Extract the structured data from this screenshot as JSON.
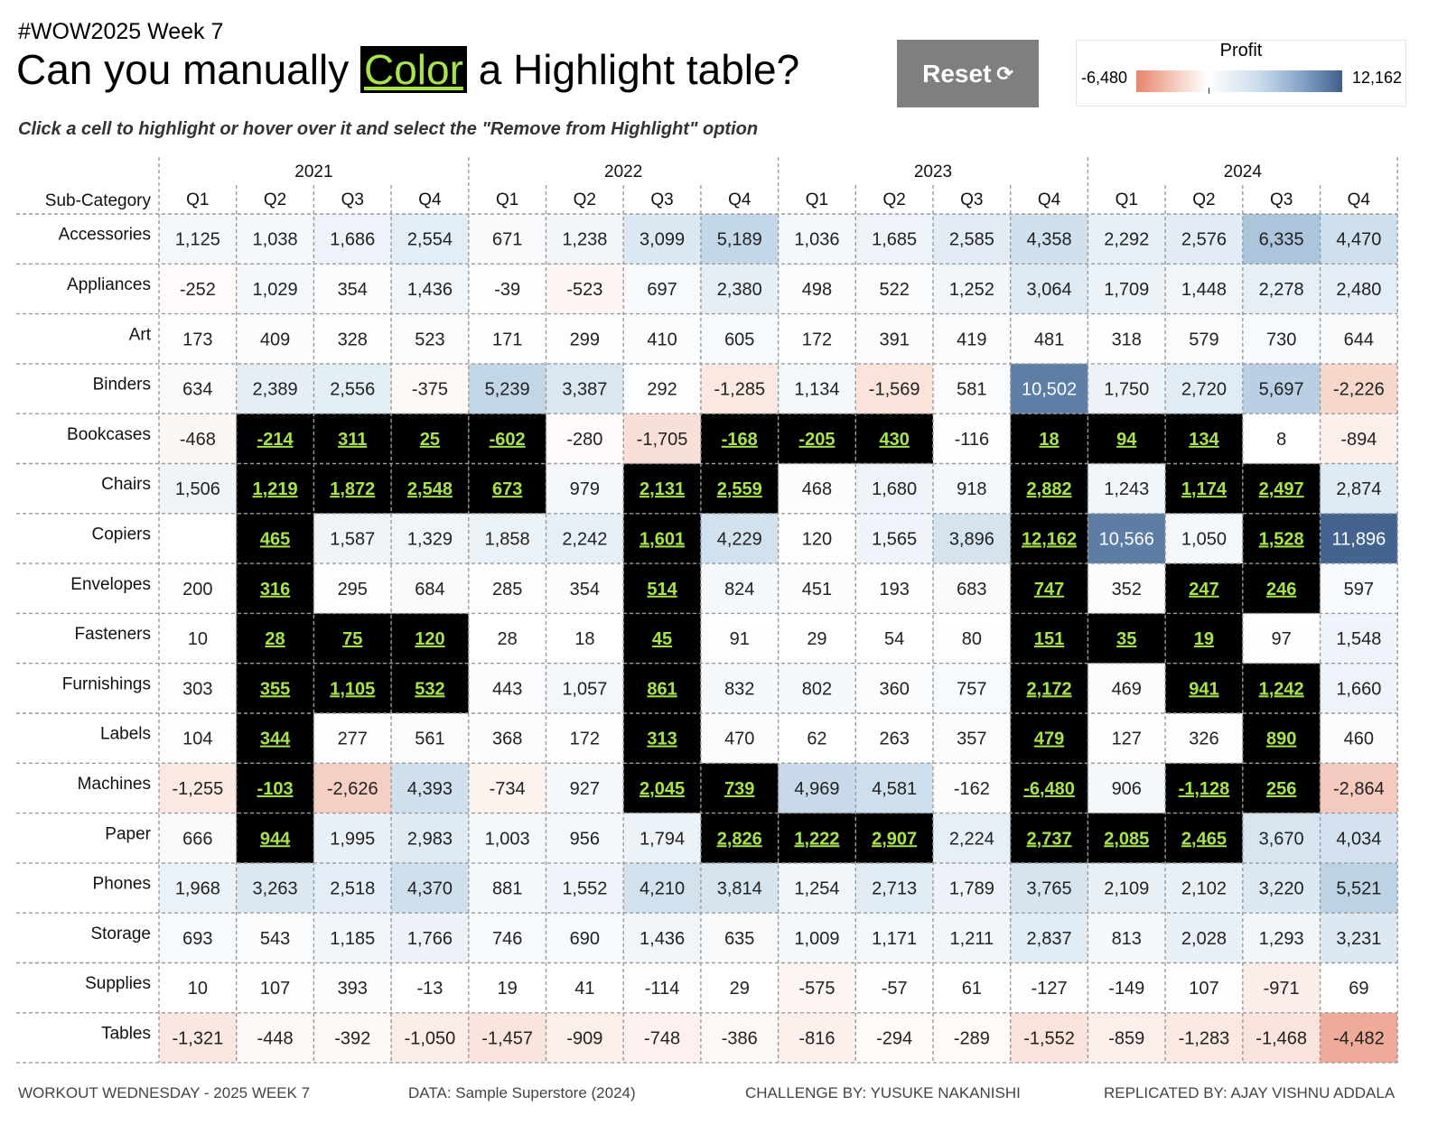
{
  "header": {
    "week_label": "#WOW2025 Week 7",
    "title_before": "Can you manually ",
    "title_highlight": "Color",
    "title_after": " a Highlight table?",
    "subtitle": "Click a cell to highlight or hover over it and select the \"Remove from Highlight\" option"
  },
  "reset": {
    "label": "Reset",
    "icon": "refresh-icon",
    "glyph": "⟳"
  },
  "legend": {
    "title": "Profit",
    "min_label": "-6,480",
    "max_label": "12,162"
  },
  "colors": {
    "negative": "#e8846c",
    "positive": "#3f5f8a",
    "highlight_bg": "#000000",
    "highlight_text": "#a6e34e",
    "reset_bg": "#7f7f7f"
  },
  "chart_data": {
    "type": "table",
    "row_header": "Sub-Category",
    "years": [
      "2021",
      "2022",
      "2023",
      "2024"
    ],
    "quarters": [
      "Q1",
      "Q2",
      "Q3",
      "Q4"
    ],
    "value_range": [
      -6480,
      12162
    ],
    "rows": [
      "Accessories",
      "Appliances",
      "Art",
      "Binders",
      "Bookcases",
      "Chairs",
      "Copiers",
      "Envelopes",
      "Fasteners",
      "Furnishings",
      "Labels",
      "Machines",
      "Paper",
      "Phones",
      "Storage",
      "Supplies",
      "Tables"
    ],
    "values": [
      [
        1125,
        1038,
        1686,
        2554,
        671,
        1238,
        3099,
        5189,
        1036,
        1685,
        2585,
        4358,
        2292,
        2576,
        6335,
        4470
      ],
      [
        -252,
        1029,
        354,
        1436,
        -39,
        -523,
        697,
        2380,
        498,
        522,
        1252,
        3064,
        1709,
        1448,
        2278,
        2480
      ],
      [
        173,
        409,
        328,
        523,
        171,
        299,
        410,
        605,
        172,
        391,
        419,
        481,
        318,
        579,
        730,
        644
      ],
      [
        634,
        2389,
        2556,
        -375,
        5239,
        3387,
        292,
        -1285,
        1134,
        -1569,
        581,
        10502,
        1750,
        2720,
        5697,
        -2226
      ],
      [
        -468,
        -214,
        311,
        25,
        -602,
        -280,
        -1705,
        -168,
        -205,
        430,
        -116,
        18,
        94,
        134,
        8,
        -894
      ],
      [
        1506,
        1219,
        1872,
        2548,
        673,
        979,
        2131,
        2559,
        468,
        1680,
        918,
        2882,
        1243,
        1174,
        2497,
        2874
      ],
      [
        null,
        465,
        1587,
        1329,
        1858,
        2242,
        1601,
        4229,
        120,
        1565,
        3896,
        12162,
        10566,
        1050,
        1528,
        11896
      ],
      [
        200,
        316,
        295,
        684,
        285,
        354,
        514,
        824,
        451,
        193,
        683,
        747,
        352,
        247,
        246,
        597
      ],
      [
        10,
        28,
        75,
        120,
        28,
        18,
        45,
        91,
        29,
        54,
        80,
        151,
        35,
        19,
        97,
        1548
      ],
      [
        303,
        355,
        1105,
        532,
        443,
        1057,
        861,
        832,
        802,
        360,
        757,
        2172,
        469,
        941,
        1242,
        1660
      ],
      [
        104,
        344,
        277,
        561,
        368,
        172,
        313,
        470,
        62,
        263,
        357,
        479,
        127,
        326,
        890,
        460
      ],
      [
        -1255,
        -103,
        -2626,
        4393,
        -734,
        927,
        2045,
        739,
        4969,
        4581,
        -162,
        -6480,
        906,
        -1128,
        256,
        -2864
      ],
      [
        666,
        944,
        1995,
        2983,
        1003,
        956,
        1794,
        2826,
        1222,
        2907,
        2224,
        2737,
        2085,
        2465,
        3670,
        4034
      ],
      [
        1968,
        3263,
        2518,
        4370,
        881,
        1552,
        4210,
        3814,
        1254,
        2713,
        1789,
        3765,
        2109,
        2102,
        3220,
        5521
      ],
      [
        693,
        543,
        1185,
        1766,
        746,
        690,
        1436,
        635,
        1009,
        1171,
        1211,
        2837,
        813,
        2028,
        1293,
        3231
      ],
      [
        10,
        107,
        393,
        -13,
        19,
        41,
        -114,
        29,
        -575,
        -57,
        61,
        -127,
        -149,
        107,
        -971,
        69
      ],
      [
        -1321,
        -448,
        -392,
        -1050,
        -1457,
        -909,
        -748,
        -386,
        -816,
        -294,
        -289,
        -1552,
        -859,
        -1283,
        -1468,
        -4482
      ]
    ],
    "highlighted": [
      [
        4,
        1
      ],
      [
        4,
        2
      ],
      [
        4,
        3
      ],
      [
        4,
        4
      ],
      [
        4,
        7
      ],
      [
        4,
        8
      ],
      [
        4,
        9
      ],
      [
        4,
        11
      ],
      [
        4,
        12
      ],
      [
        4,
        13
      ],
      [
        5,
        1
      ],
      [
        5,
        2
      ],
      [
        5,
        3
      ],
      [
        5,
        4
      ],
      [
        5,
        6
      ],
      [
        5,
        7
      ],
      [
        5,
        11
      ],
      [
        5,
        13
      ],
      [
        5,
        14
      ],
      [
        6,
        1
      ],
      [
        6,
        6
      ],
      [
        6,
        11
      ],
      [
        6,
        14
      ],
      [
        7,
        1
      ],
      [
        7,
        6
      ],
      [
        7,
        11
      ],
      [
        7,
        13
      ],
      [
        7,
        14
      ],
      [
        8,
        1
      ],
      [
        8,
        2
      ],
      [
        8,
        3
      ],
      [
        8,
        6
      ],
      [
        8,
        11
      ],
      [
        8,
        12
      ],
      [
        8,
        13
      ],
      [
        9,
        1
      ],
      [
        9,
        2
      ],
      [
        9,
        3
      ],
      [
        9,
        6
      ],
      [
        9,
        11
      ],
      [
        9,
        13
      ],
      [
        9,
        14
      ],
      [
        10,
        1
      ],
      [
        10,
        6
      ],
      [
        10,
        11
      ],
      [
        10,
        14
      ],
      [
        11,
        1
      ],
      [
        11,
        6
      ],
      [
        11,
        7
      ],
      [
        11,
        11
      ],
      [
        11,
        13
      ],
      [
        11,
        14
      ],
      [
        12,
        1
      ],
      [
        12,
        7
      ],
      [
        12,
        8
      ],
      [
        12,
        9
      ],
      [
        12,
        11
      ],
      [
        12,
        12
      ],
      [
        12,
        13
      ]
    ]
  },
  "footer": {
    "left": "WORKOUT WEDNESDAY - 2025 WEEK 7",
    "data": "DATA: Sample Superstore (2024)",
    "challenge": "CHALLENGE BY: YUSUKE NAKANISHI",
    "replicated": "REPLICATED BY: AJAY VISHNU ADDALA"
  }
}
